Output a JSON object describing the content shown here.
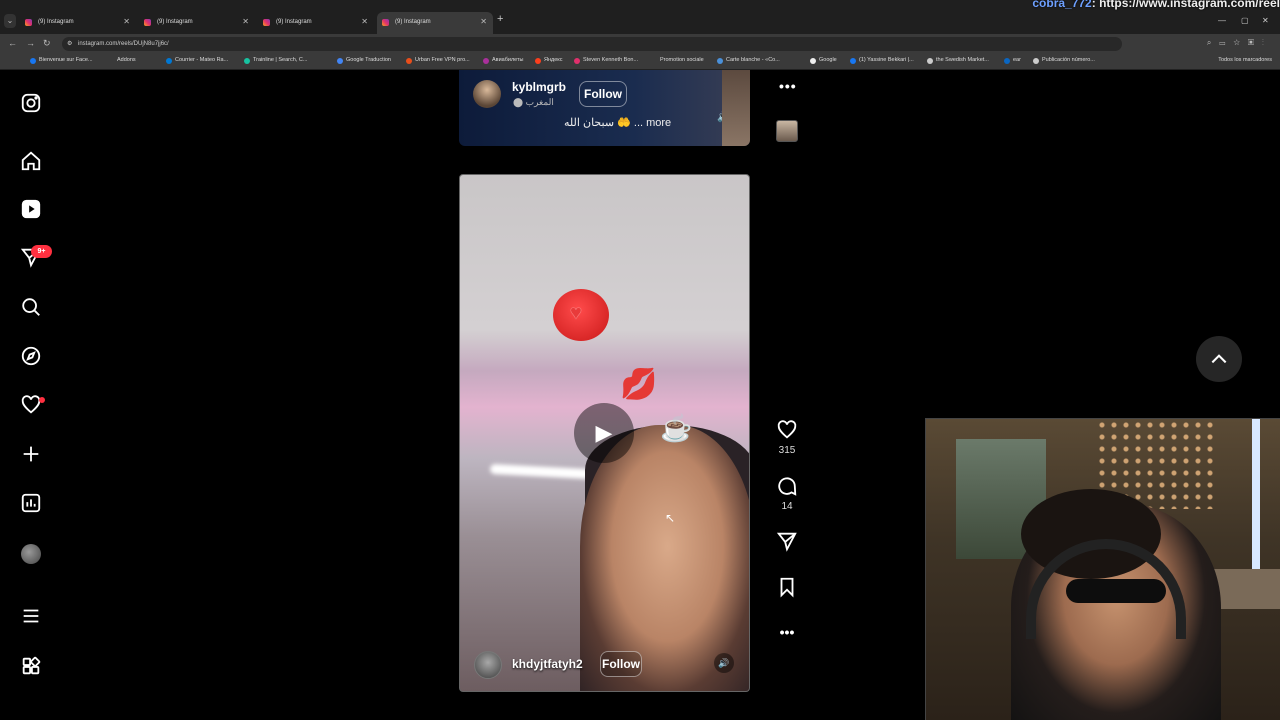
{
  "browser": {
    "tabs": [
      {
        "title": "(9) Instagram"
      },
      {
        "title": "(9) Instagram"
      },
      {
        "title": "(9) Instagram"
      },
      {
        "title": "(9) Instagram"
      }
    ],
    "url": "instagram.com/reels/DUjN8u7jj6c/",
    "stream_overlay_user": "cobra_772",
    "stream_overlay_text": ": https://www.instagram.com/reel",
    "bookmarks": [
      "Bienvenue sur Face...",
      "Addons",
      "Courrier - Mateo Ra...",
      "Trainline | Search, C...",
      "Google Traduction",
      "Urban Free VPN pro...",
      "Авиабилеты",
      "Яндекс",
      "Steven Kenneth Bon...",
      "Promotion sociale",
      "Carte blanche - «Co...",
      "Google",
      "(1) Yassine Bekkari |...",
      "the Swedish Market...",
      "ear",
      "Publicación número..."
    ],
    "bookmarks_all": "Todos los marcadores"
  },
  "sidebar": {
    "notification_badge": "9+"
  },
  "reel_prev": {
    "username": "kyblmgrb",
    "location": "المغرب",
    "follow_label": "Follow",
    "caption": "سبحان الله 🤲 ... more"
  },
  "reel": {
    "username": "khdyjtfatyh2",
    "follow_label": "Follow",
    "likes": "315",
    "comments": "14"
  },
  "icons": {
    "logo": "instagram-icon",
    "home": "home-icon",
    "reels": "reels-icon",
    "messages": "send-icon",
    "search": "search-icon",
    "explore": "compass-icon",
    "notifications": "heart-icon",
    "create": "plus-icon",
    "dashboard": "chart-icon",
    "menu": "hamburger-icon",
    "more": "apps-icon"
  }
}
